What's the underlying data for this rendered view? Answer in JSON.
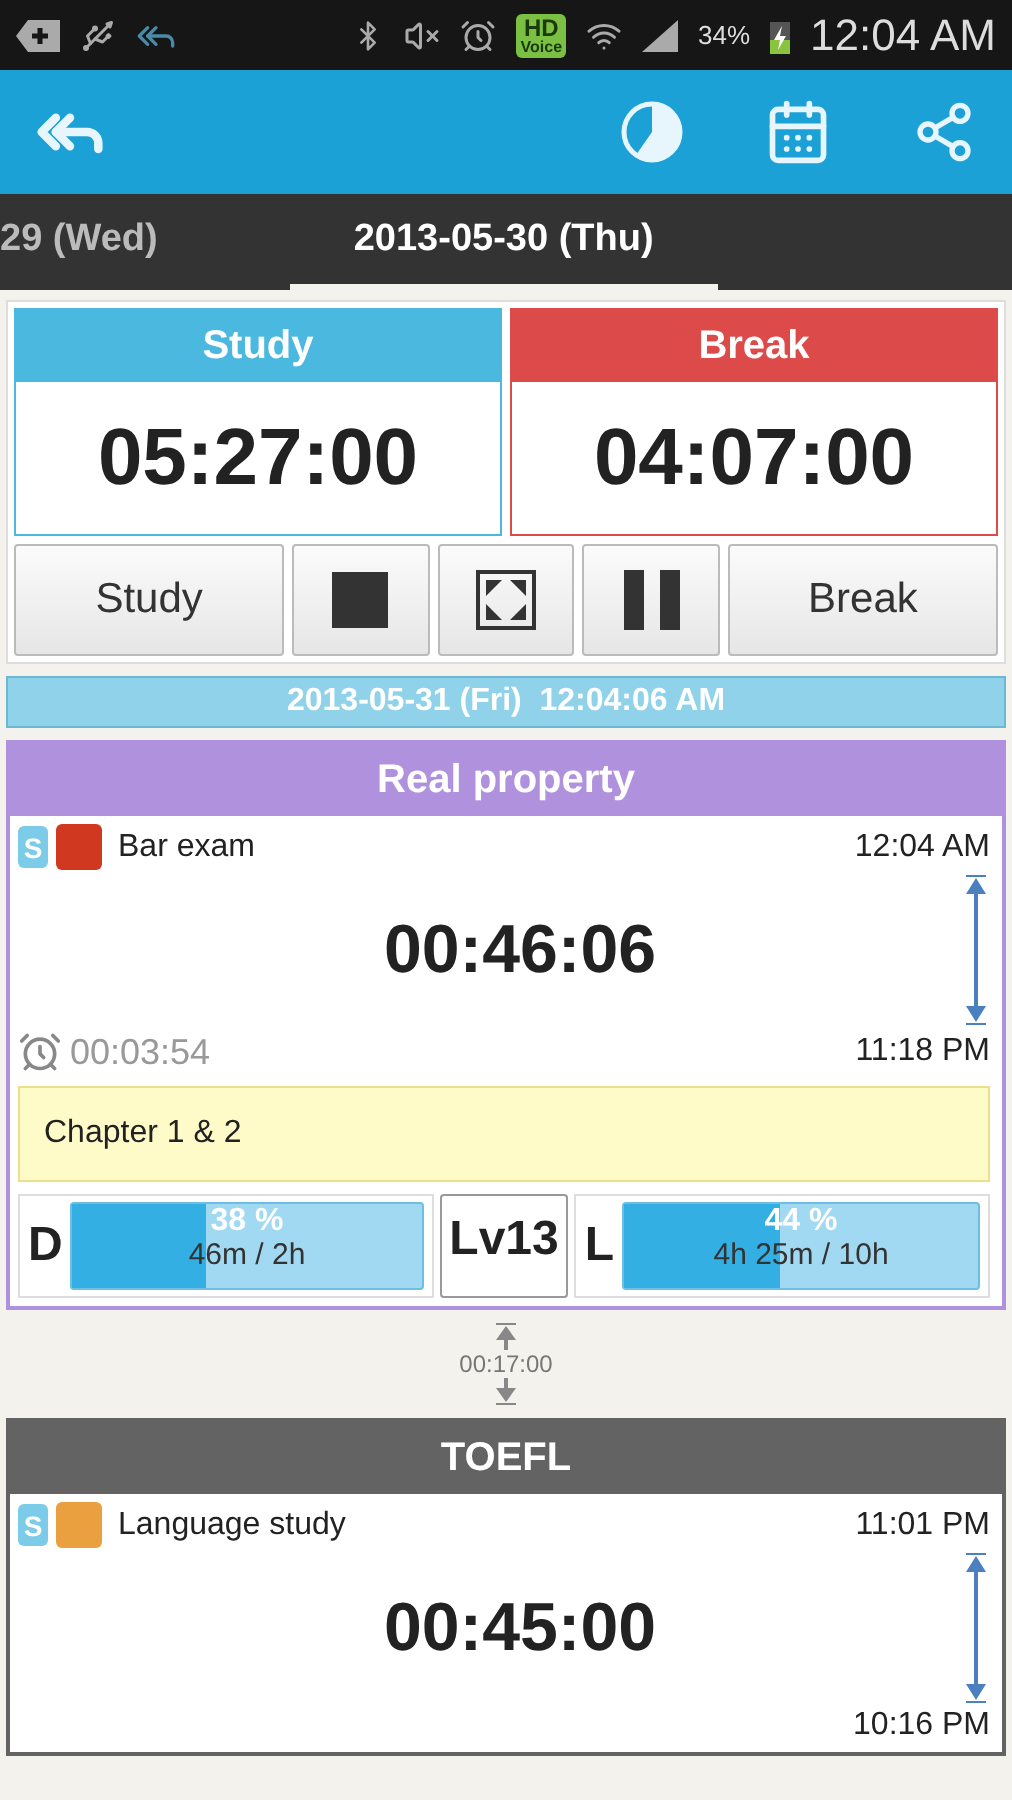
{
  "status_bar": {
    "hd_badge": {
      "top": "HD",
      "bottom": "Voice"
    },
    "battery": "34%",
    "time": "12:04 AM"
  },
  "day_tabs": [
    {
      "label": "29 (Wed)",
      "selected": false
    },
    {
      "label": "2013-05-30 (Thu)",
      "selected": true
    }
  ],
  "timers": [
    {
      "kind": "study",
      "title": "Study",
      "value": "05:27:00"
    },
    {
      "kind": "break",
      "title": "Break",
      "value": "04:07:00"
    }
  ],
  "controls": [
    {
      "kind": "text",
      "label": "Study"
    },
    {
      "kind": "stop"
    },
    {
      "kind": "fullscreen"
    },
    {
      "kind": "pause"
    },
    {
      "kind": "text",
      "label": "Break"
    }
  ],
  "current_datetime": "2013-05-31 (Fri)  12:04:06 AM",
  "timeline": [
    {
      "kind": "session",
      "title": "Real property",
      "color": "#b091dd",
      "badge": "S",
      "tag": {
        "color": "#d0391f"
      },
      "category": "Bar exam",
      "start": "12:04 AM",
      "duration": "00:46:06",
      "end": "11:18 PM",
      "alarm": "00:03:54",
      "note": "Chapter 1 & 2",
      "goals": [
        {
          "label": "D",
          "level": 0.38,
          "percent": "38 %",
          "detail": "46m / 2h"
        },
        {
          "label": "L",
          "level": 0.44,
          "percent": "44 %",
          "detail": "4h 25m / 10h"
        }
      ],
      "level_badge": "Lv13"
    },
    {
      "kind": "gap",
      "duration": "00:17:00"
    },
    {
      "kind": "session",
      "title": "TOEFL",
      "color": "#636363",
      "badge": "S",
      "tag": {
        "color": "#eba03f"
      },
      "category": "Language study",
      "start": "11:01 PM",
      "duration": "00:45:00",
      "end": "10:16 PM"
    }
  ]
}
